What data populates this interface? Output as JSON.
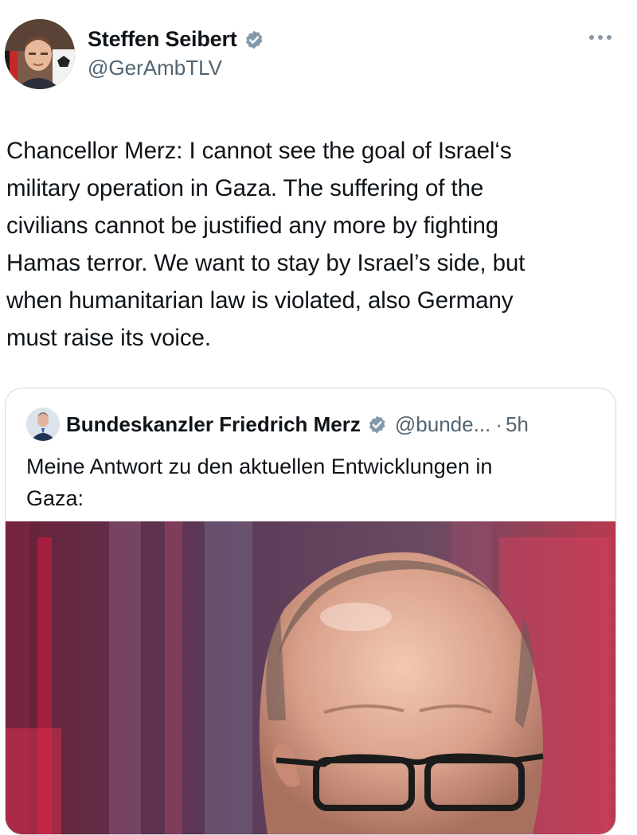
{
  "author": {
    "name": "Steffen Seibert",
    "handle": "@GerAmbTLV"
  },
  "tweet": {
    "lines": [
      "Chancellor Merz: I cannot see the goal of Israel‘s",
      "military operation in Gaza. The suffering of the",
      "civilians cannot be justified any more by fighting",
      "Hamas terror. We want to stay by Israel’s side, but",
      "when humanitarian law is violated, also Germany",
      "must raise its voice."
    ]
  },
  "quoted_tweet": {
    "name": "Bundeskanzler Friedrich Merz",
    "handle": "@bunde...",
    "separator": "·",
    "time": "5h",
    "lines": [
      "Meine Antwort zu den aktuellen Entwicklungen in",
      "Gaza:"
    ]
  },
  "icons": {
    "verified": "verified-badge-icon",
    "more": "more-options-icon"
  },
  "colors": {
    "text": "#0f1419",
    "secondary": "#536471",
    "verified_badge": "#829aab",
    "border": "#cfd9de",
    "media_accent": "#d61c3c"
  }
}
